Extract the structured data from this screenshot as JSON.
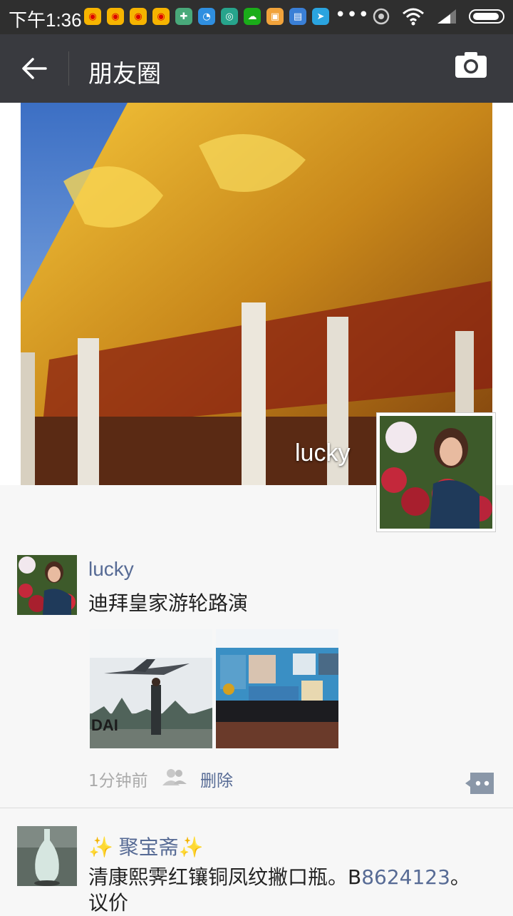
{
  "status_bar": {
    "time": "下午1:36",
    "more": "•••"
  },
  "app_bar": {
    "title": "朋友圈"
  },
  "cover": {
    "username": "lucky"
  },
  "posts": [
    {
      "author": "lucky",
      "text": "迪拜皇家游轮路演",
      "time": "1分钟前",
      "delete_label": "删除"
    },
    {
      "author": "✨ 聚宝斋✨",
      "text_prefix": "清康熙霁红镶铜凤纹撇口瓶。B",
      "text_link": "8624123",
      "text_suffix": "。",
      "text_line2": "议价"
    }
  ],
  "colors": {
    "status_bar_bg": "#2f2f2f",
    "app_bar_bg": "#393a3f",
    "link_blue": "#576b95",
    "page_bg": "#f7f7f7"
  }
}
